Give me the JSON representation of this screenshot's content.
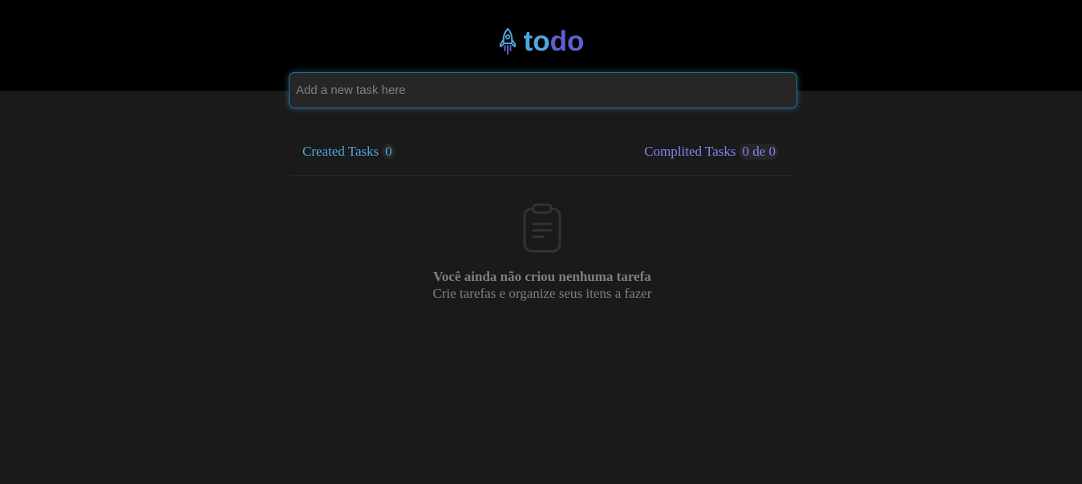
{
  "header": {
    "logo_icon": "rocket-icon",
    "logo_part1": "to",
    "logo_part2": "do",
    "colors": {
      "blue": "#4ea8de",
      "purple": "#5e60ce"
    }
  },
  "task_input": {
    "placeholder": "Add a new task here",
    "value": ""
  },
  "stats": {
    "created_label": "Created Tasks",
    "created_count": "0",
    "completed_label": "Complited Tasks",
    "completed_count": "0 de 0"
  },
  "empty_state": {
    "icon": "clipboard-icon",
    "title": "Você ainda não criou nenhuma tarefa",
    "subtitle": "Crie tarefas e organize seus itens a fazer"
  }
}
